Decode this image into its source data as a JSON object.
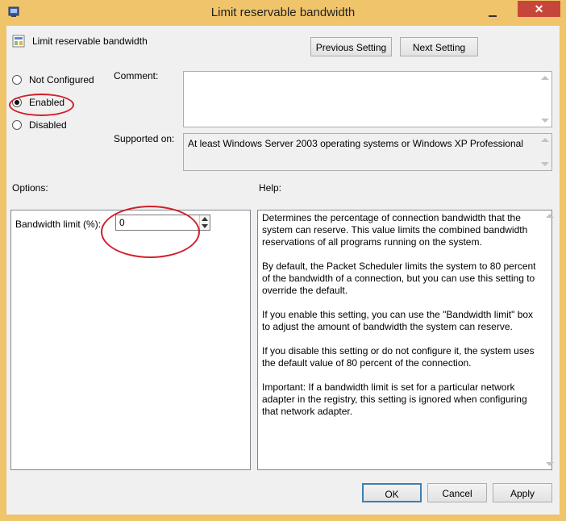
{
  "window": {
    "title": "Limit reservable bandwidth",
    "close_glyph": "✕",
    "accent": "#f0c46a",
    "close_color": "#c7463a"
  },
  "header": {
    "policy_name": "Limit reservable bandwidth",
    "previous_label": "Previous Setting",
    "next_label": "Next Setting"
  },
  "state": {
    "options": [
      "Not Configured",
      "Enabled",
      "Disabled"
    ],
    "selected": "Enabled"
  },
  "comment": {
    "label": "Comment:",
    "value": ""
  },
  "supported": {
    "label": "Supported on:",
    "value": "At least Windows Server 2003 operating systems or Windows XP Professional"
  },
  "options_panel": {
    "label": "Options:",
    "bandwidth_label": "Bandwidth limit (%):",
    "bandwidth_value": "0"
  },
  "help": {
    "label": "Help:",
    "text": "Determines the percentage of connection bandwidth that the system can reserve. This value limits the combined bandwidth reservations of all programs running on the system.\n\nBy default, the Packet Scheduler limits the system to 80 percent of the bandwidth of a connection, but you can use this setting to override the default.\n\nIf you enable this setting, you can use the \"Bandwidth limit\" box to adjust the amount of bandwidth the system can reserve.\n\nIf you disable this setting or do not configure it, the system uses the default value of 80 percent of the connection.\n\nImportant: If a bandwidth limit is set for a particular network adapter in the registry, this setting is ignored when configuring that network adapter."
  },
  "footer": {
    "ok_label": "OK",
    "cancel_label": "Cancel",
    "apply_label": "Apply"
  },
  "annotation_color": "#d0202a"
}
